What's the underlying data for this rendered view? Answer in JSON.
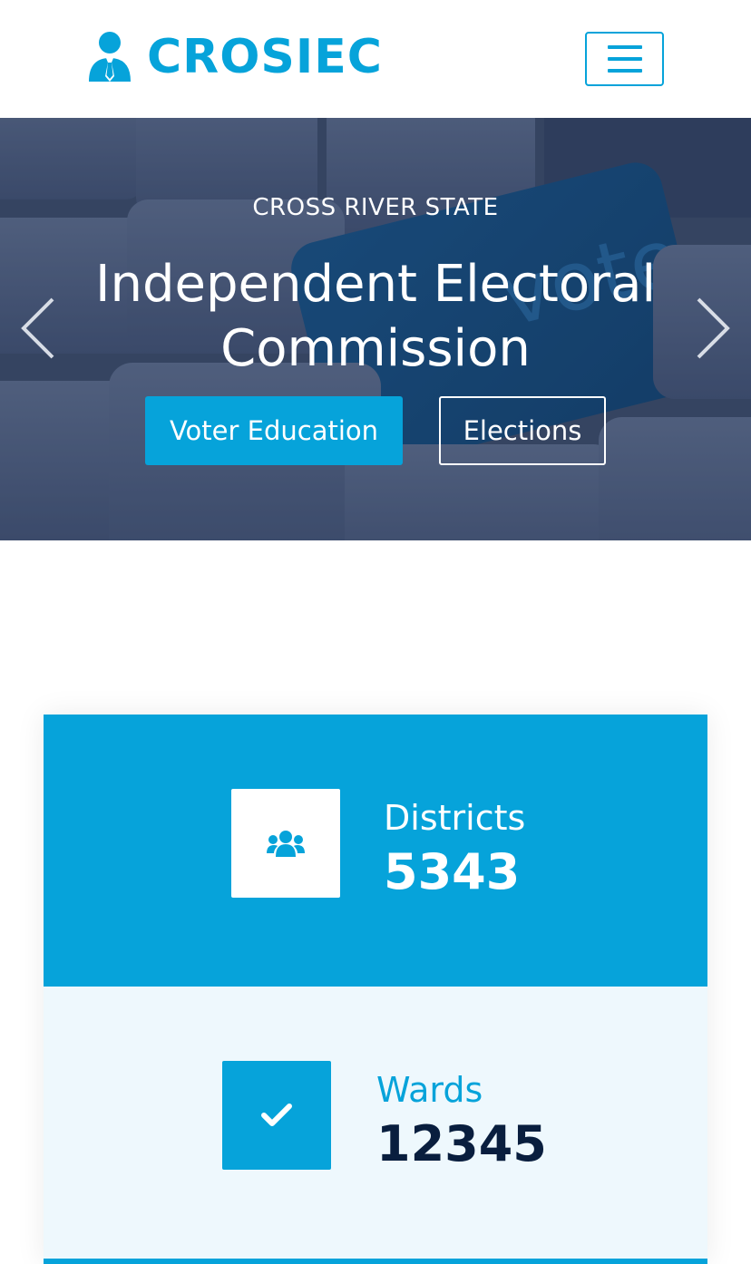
{
  "colors": {
    "accent": "#06a3da",
    "dark": "#091e3e",
    "light_bg": "#eef8fd",
    "white": "#ffffff"
  },
  "header": {
    "brand_name": "CROSIEC",
    "brand_icon": "user-tie-icon",
    "menu_icon": "hamburger-menu-icon"
  },
  "hero": {
    "eyebrow": "CROSS RIVER STATE",
    "title": "Independent Electoral Commission",
    "primary_button": "Voter Education",
    "secondary_button": "Elections",
    "prev_icon": "chevron-left-icon",
    "next_icon": "chevron-right-icon"
  },
  "stats": [
    {
      "label": "Districts",
      "value": "5343",
      "icon": "users-icon"
    },
    {
      "label": "Wards",
      "value": "12345",
      "icon": "check-icon"
    }
  ]
}
